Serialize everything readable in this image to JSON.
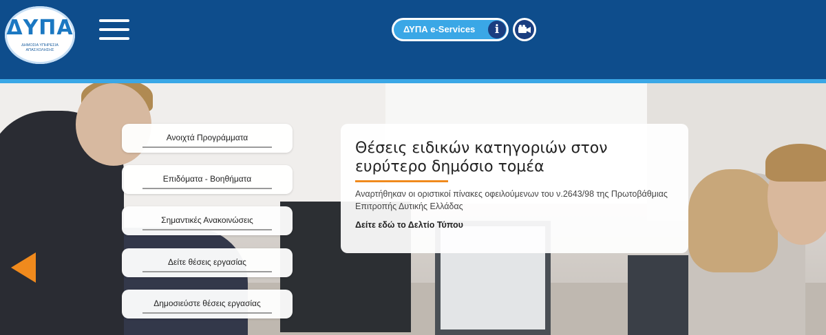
{
  "header": {
    "logo_text": "ΔΥΠΑ",
    "logo_subtitle": "ΔΗΜΟΣΙΑ ΥΠΗΡΕΣΙΑ ΑΠΑΣΧΟΛΗΣΗΣ",
    "eservices_label": "ΔΥΠΑ e-Services",
    "info_icon": "i",
    "colors": {
      "header_bg": "#0e4d8c",
      "accent": "#3aa7e6",
      "dark_icon": "#1a3e80"
    }
  },
  "menu": {
    "items": [
      {
        "label": "Ανοιχτά Προγράμματα"
      },
      {
        "label": "Επιδόματα - Βοηθήματα"
      },
      {
        "label": "Σημαντικές Ανακοινώσεις"
      },
      {
        "label": "Δείτε θέσεις εργασίας"
      },
      {
        "label": "Δημοσιεύστε θέσεις εργασίας"
      }
    ]
  },
  "news": {
    "title": "Θέσεις ειδικών κατηγοριών στον ευρύτερο δημόσιο τομέα",
    "text": "Αναρτήθηκαν οι οριστικοί πίνακες οφειλούμενων του ν.2643/98  της Πρωτοβάθμιας Επιτροπής Δυτικής Ελλάδας",
    "link": "Δείτε εδώ το Δελτίο Τύπου",
    "accent_color": "#f08a1d"
  },
  "icons": {
    "menu": "hamburger-menu-icon",
    "info": "info-icon",
    "video": "video-camera-icon",
    "prev": "arrow-left-icon"
  }
}
